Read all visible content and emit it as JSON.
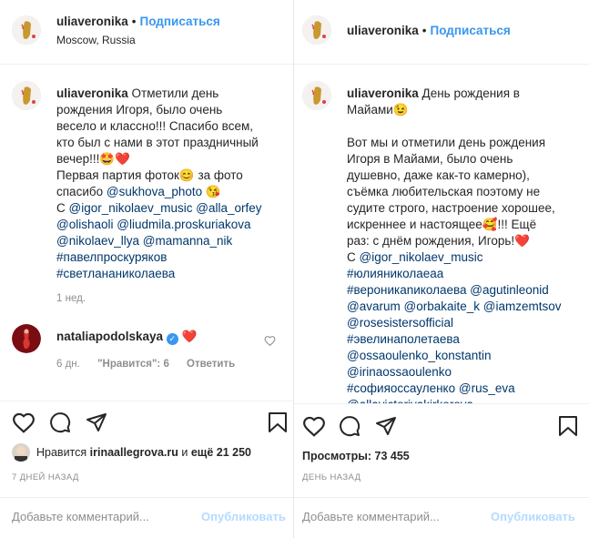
{
  "left": {
    "username": "uliaveronika",
    "dot": "•",
    "follow": "Подписаться",
    "location": "Moscow, Russia",
    "caption": {
      "user": "uliaveronika",
      "l1": " Отметили день",
      "l2": "рождения Игоря, было очень",
      "l3": "весело и классно!!! Спасибо всем,",
      "l4": "кто был с нами в этот праздничный",
      "l5": "вечер!!!🤩❤️",
      "l6": "Первая партия фоток😊 за фото",
      "l7a": "спасибо ",
      "l7b": "@sukhova_photo",
      "l7c": " 😘",
      "l8a": "С ",
      "l8b": "@igor_nikolaev_music",
      "l8c": " ",
      "l8d": "@alla_orfey",
      "l9a": "@olishaoli",
      "l9b": " ",
      "l9c": "@liudmila.proskuriakova",
      "l10a": "@nikolaev_llya",
      "l10b": " ",
      "l10c": "@mamanna_nik",
      "l11": "#павелпроскуряков",
      "l12": "#светлананиколаева"
    },
    "caption_time": "1 нед.",
    "comment": {
      "user": "nataliapodolskaya",
      "verified": "✓",
      "heart": "❤️",
      "time": "6 дн.",
      "likes": "\"Нравится\": 6",
      "reply": "Ответить"
    },
    "likes": {
      "prefix": "Нравится ",
      "user": "irinaallegrova.ru",
      "mid": " и ",
      "rest": "ещё 21 250"
    },
    "date": "7 ДНЕЙ НАЗАД",
    "comment_placeholder": "Добавьте комментарий...",
    "publish": "Опубликовать"
  },
  "right": {
    "username": "uliaveronika",
    "dot": "•",
    "follow": "Подписаться",
    "caption": {
      "user": "uliaveronika",
      "l1": " День рождения в",
      "l2": "Майами😉",
      "l3": "Вот мы и отметили день рождения",
      "l4": "Игоря в Майами, было очень",
      "l5": "душевно, даже как-то камерно),",
      "l6": "съёмка любительская поэтому не",
      "l7": "судите строго, настроение хорошее,",
      "l8": "искреннее и настоящее🥰!!! Ещё",
      "l9": "раз: с днём рождения, Игорь!❤️",
      "l10a": "С ",
      "l10b": "@igor_nikolaev_music",
      "l11": "#юлияниколаеаа",
      "l12a": "#вероникаnиколаева",
      "l12b": " ",
      "l12c": "@agutinleonid",
      "l13a": "@avarum",
      "l13b": " ",
      "l13c": "@orbakaite_k",
      "l13d": " ",
      "l13e": "@iamzemtsov",
      "l14": "@rosesistersofficial",
      "l15": "#эвелинаполетаева",
      "l16": "@ossaoulenko_konstantin",
      "l17": "@irinaossaoulenko",
      "l18a": "#софияоссауленко",
      "l18b": " ",
      "l18c": "@rus_eva",
      "l19": "@allavictoriyakirkorova"
    },
    "views": {
      "label": "Просмотры: ",
      "count": "73 455"
    },
    "date": "ДЕНЬ НАЗАД",
    "comment_placeholder": "Добавьте комментарий...",
    "publish": "Опубликовать"
  },
  "colors": {
    "link": "#00376b",
    "follow": "#3897f0",
    "muted": "#8e8e8e",
    "publish_disabled": "#b3dbff",
    "heart": "#ed4956",
    "verified": "#3897f0"
  },
  "icons": [
    "heart-icon",
    "comment-icon",
    "share-icon",
    "bookmark-icon",
    "verified-icon",
    "small-heart-icon"
  ]
}
